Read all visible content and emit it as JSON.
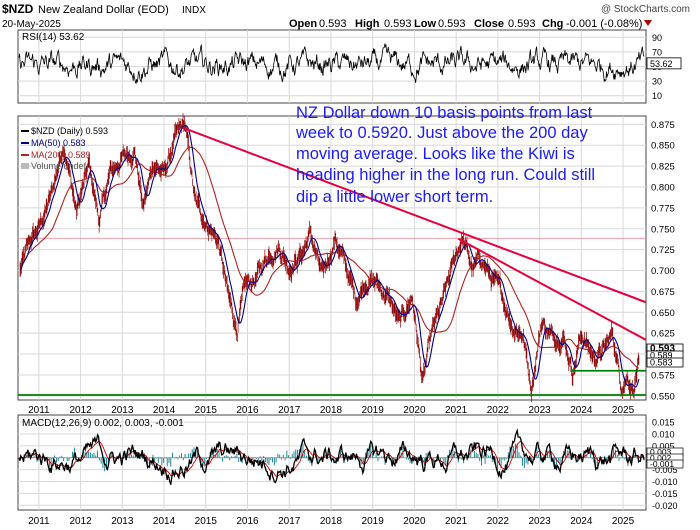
{
  "header": {
    "symbol": "$NZD",
    "name": "New Zealand Dollar (EOD)",
    "exchange": "INDX",
    "date": "20-May-2025",
    "watermark": "@ StockCharts.com",
    "quote": {
      "open_label": "Open",
      "open": "0.593",
      "high_label": "High",
      "high": "0.593",
      "low_label": "Low",
      "low": "0.593",
      "close_label": "Close",
      "close": "0.593",
      "chg_label": "Chg",
      "chg": "-0.001 (-0.08%)"
    }
  },
  "colors": {
    "price": "#8b0000",
    "ma50": "#00008b",
    "ma200": "#b22222",
    "trend": "#e8003a",
    "support": "#008000",
    "annotation": "#1a1aff",
    "grid": "#d8d8d8",
    "macd": "#000000",
    "signal": "#d00000",
    "hist": "#0a7a8a"
  },
  "annotation": {
    "lines": [
      "NZ Dollar down 10 basis points from last",
      "week to 0.5920. Just above the 200 day",
      "moving average. Looks like the Kiwi is",
      "heading higher in the long run. Could still",
      "dip a little lower short term."
    ]
  },
  "chart_data": [
    {
      "type": "line",
      "panel": "rsi",
      "title": "RSI(14) 53.62",
      "y_ticks": [
        10,
        30,
        50,
        70,
        90
      ],
      "ylim": [
        0,
        100
      ],
      "last_value": "53.62",
      "oscillation_range": [
        30,
        70
      ]
    },
    {
      "type": "line",
      "panel": "price",
      "legend": [
        {
          "name": "$NZD (Daily) 0.593",
          "color": "#000000"
        },
        {
          "name": "MA(50) 0.583",
          "color": "#00008b"
        },
        {
          "name": "MA(200) 0.589",
          "color": "#b22222"
        },
        {
          "name": "Volume undef",
          "color": "#888888"
        }
      ],
      "ylim": [
        0.545,
        0.885
      ],
      "y_ticks": [
        "0.550",
        "0.575",
        "0.600",
        "0.625",
        "0.650",
        "0.675",
        "0.700",
        "0.725",
        "0.750",
        "0.775",
        "0.800",
        "0.825",
        "0.850",
        "0.875"
      ],
      "x_ticks": [
        "2011",
        "2012",
        "2013",
        "2014",
        "2015",
        "2016",
        "2017",
        "2018",
        "2019",
        "2020",
        "2021",
        "2022",
        "2023",
        "2024",
        "2025"
      ],
      "price_points": [
        {
          "x": 2010.55,
          "y": 0.7
        },
        {
          "x": 2010.8,
          "y": 0.735
        },
        {
          "x": 2011.0,
          "y": 0.75
        },
        {
          "x": 2011.3,
          "y": 0.79
        },
        {
          "x": 2011.6,
          "y": 0.855
        },
        {
          "x": 2011.9,
          "y": 0.77
        },
        {
          "x": 2012.2,
          "y": 0.825
        },
        {
          "x": 2012.45,
          "y": 0.76
        },
        {
          "x": 2012.7,
          "y": 0.815
        },
        {
          "x": 2013.0,
          "y": 0.835
        },
        {
          "x": 2013.3,
          "y": 0.845
        },
        {
          "x": 2013.5,
          "y": 0.775
        },
        {
          "x": 2013.75,
          "y": 0.83
        },
        {
          "x": 2014.0,
          "y": 0.815
        },
        {
          "x": 2014.25,
          "y": 0.855
        },
        {
          "x": 2014.5,
          "y": 0.875
        },
        {
          "x": 2014.75,
          "y": 0.78
        },
        {
          "x": 2015.0,
          "y": 0.76
        },
        {
          "x": 2015.3,
          "y": 0.735
        },
        {
          "x": 2015.55,
          "y": 0.665
        },
        {
          "x": 2015.75,
          "y": 0.63
        },
        {
          "x": 2015.95,
          "y": 0.68
        },
        {
          "x": 2016.2,
          "y": 0.69
        },
        {
          "x": 2016.5,
          "y": 0.72
        },
        {
          "x": 2016.75,
          "y": 0.73
        },
        {
          "x": 2017.0,
          "y": 0.705
        },
        {
          "x": 2017.3,
          "y": 0.72
        },
        {
          "x": 2017.5,
          "y": 0.745
        },
        {
          "x": 2017.8,
          "y": 0.69
        },
        {
          "x": 2018.1,
          "y": 0.74
        },
        {
          "x": 2018.35,
          "y": 0.705
        },
        {
          "x": 2018.6,
          "y": 0.665
        },
        {
          "x": 2018.85,
          "y": 0.69
        },
        {
          "x": 2019.1,
          "y": 0.685
        },
        {
          "x": 2019.4,
          "y": 0.665
        },
        {
          "x": 2019.65,
          "y": 0.635
        },
        {
          "x": 2019.95,
          "y": 0.67
        },
        {
          "x": 2020.2,
          "y": 0.565
        },
        {
          "x": 2020.4,
          "y": 0.62
        },
        {
          "x": 2020.7,
          "y": 0.665
        },
        {
          "x": 2021.0,
          "y": 0.72
        },
        {
          "x": 2021.15,
          "y": 0.74
        },
        {
          "x": 2021.4,
          "y": 0.7
        },
        {
          "x": 2021.6,
          "y": 0.715
        },
        {
          "x": 2021.85,
          "y": 0.69
        },
        {
          "x": 2022.1,
          "y": 0.67
        },
        {
          "x": 2022.35,
          "y": 0.635
        },
        {
          "x": 2022.6,
          "y": 0.625
        },
        {
          "x": 2022.8,
          "y": 0.56
        },
        {
          "x": 2023.05,
          "y": 0.64
        },
        {
          "x": 2023.3,
          "y": 0.62
        },
        {
          "x": 2023.55,
          "y": 0.625
        },
        {
          "x": 2023.8,
          "y": 0.58
        },
        {
          "x": 2024.0,
          "y": 0.625
        },
        {
          "x": 2024.3,
          "y": 0.595
        },
        {
          "x": 2024.55,
          "y": 0.605
        },
        {
          "x": 2024.75,
          "y": 0.625
        },
        {
          "x": 2024.95,
          "y": 0.565
        },
        {
          "x": 2025.1,
          "y": 0.575
        },
        {
          "x": 2025.25,
          "y": 0.56
        },
        {
          "x": 2025.38,
          "y": 0.593
        }
      ],
      "trendlines": [
        {
          "name": "upper-trendline",
          "x": [
            2014.45,
            2025.55
          ],
          "y": [
            0.871,
            0.662
          ]
        },
        {
          "name": "lower-trendline",
          "x": [
            2021.05,
            2025.55
          ],
          "y": [
            0.738,
            0.617
          ]
        }
      ],
      "support_lines": [
        {
          "name": "support-0.551",
          "x": [
            2010.5,
            2025.55
          ],
          "y": [
            0.551,
            0.551
          ]
        },
        {
          "name": "support-0.580",
          "x": [
            2023.75,
            2025.55
          ],
          "y": [
            0.58,
            0.58
          ]
        }
      ],
      "reference_line": {
        "y": 0.7385
      },
      "last_labels": [
        {
          "value": "0.593",
          "y": 0.593,
          "style": "bold"
        },
        {
          "value": "0.589",
          "y": 0.589,
          "style": "normal"
        },
        {
          "value": "0.583",
          "y": 0.583,
          "style": "normal"
        }
      ]
    },
    {
      "type": "line",
      "panel": "macd",
      "title": "MACD(12,26,9) 0.002, 0.003, -0.001",
      "ylim": [
        -0.022,
        0.018
      ],
      "y_ticks": [
        "0.015",
        "0.010",
        "0.005",
        "0.000",
        "-0.005",
        "-0.010",
        "-0.015",
        "-0.020"
      ],
      "last_labels": [
        {
          "value": "0.003",
          "y": 0.003
        },
        {
          "value": "0.002",
          "y": 0.0015
        },
        {
          "value": "-0.001",
          "y": -0.001
        }
      ]
    }
  ]
}
